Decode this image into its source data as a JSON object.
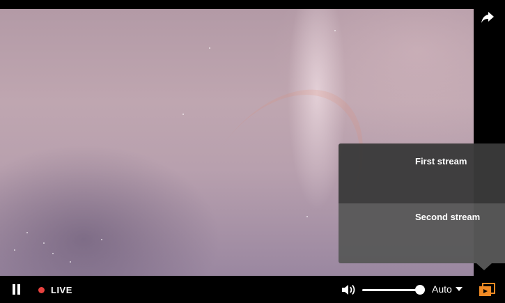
{
  "stream_menu": {
    "items": [
      {
        "label": "First stream"
      },
      {
        "label": "Second stream"
      }
    ]
  },
  "controls": {
    "live_label": "LIVE",
    "live_color": "#e8423f",
    "quality_label": "Auto",
    "volume_level_percent": 100,
    "accent_color": "#f08a24"
  },
  "icons": {
    "play_state": "pause-icon",
    "share": "share-arrow-icon",
    "volume": "speaker-icon",
    "streams": "stream-list-icon"
  }
}
